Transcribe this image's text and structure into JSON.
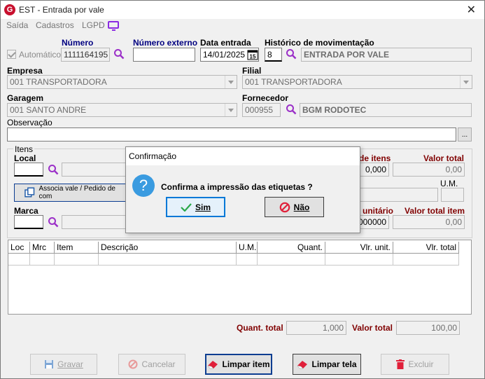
{
  "window": {
    "title": "EST - Entrada por vale",
    "close": "✕",
    "app_icon": "G"
  },
  "menu": {
    "items": [
      "Saída",
      "Cadastros",
      "LGPD"
    ]
  },
  "header": {
    "automatico_label": "Automático",
    "numero_label": "Número",
    "numero_value": "1111164195",
    "numero_externo_label": "Número externo",
    "numero_externo_value": "",
    "data_entrada_label": "Data entrada",
    "data_entrada_value": "14/01/2025",
    "cal_text": "15",
    "historico_label": "Histórico de movimentação",
    "historico_code": "8",
    "historico_desc": "ENTRADA POR VALE"
  },
  "empresa": {
    "label": "Empresa",
    "value": "001 TRANSPORTADORA"
  },
  "filial": {
    "label": "Filial",
    "value": "001 TRANSPORTADORA"
  },
  "garagem": {
    "label": "Garagem",
    "value": "001 SANTO ANDRE"
  },
  "fornecedor": {
    "label": "Fornecedor",
    "code": "000955",
    "name": "BGM RODOTEC"
  },
  "observacao": {
    "label": "Observação",
    "value": "",
    "ellipsis": "..."
  },
  "itens": {
    "group_label": "Itens",
    "local_label": "Local",
    "associa_button": "Associa vale / Pedido de com",
    "marca_label": "Marca",
    "qtd_itens_label": "de itens",
    "qtd_itens_value": "0,000",
    "valor_total_label": "Valor total",
    "valor_total_value": "0,00",
    "um_label": "U.M.",
    "valor_unitario_label": "r unitário",
    "valor_unitario_value": ",000000",
    "valor_total_item_label": "Valor total item",
    "valor_total_item_value": "0,00"
  },
  "grid": {
    "columns": [
      "Loc",
      "Mrc",
      "Item",
      "Descrição",
      "U.M.",
      "Quant.",
      "Vlr. unit.",
      "Vlr. total"
    ]
  },
  "totals": {
    "quant_label": "Quant. total",
    "quant_value": "1,000",
    "valor_label": "Valor total",
    "valor_value": "100,00"
  },
  "buttons": {
    "gravar": "Gravar",
    "cancelar": "Cancelar",
    "limpar_item": "Limpar item",
    "limpar_tela": "Limpar tela",
    "excluir": "Excluir"
  },
  "dialog": {
    "title": "Confirmação",
    "icon": "?",
    "message": "Confirma a impressão das etiquetas ?",
    "sim": "Sim",
    "nao": "Não"
  },
  "colors": {
    "navy": "#000080",
    "maroon": "#800000",
    "accent_purple": "#8b2be2",
    "question_blue": "#3a9be0"
  }
}
